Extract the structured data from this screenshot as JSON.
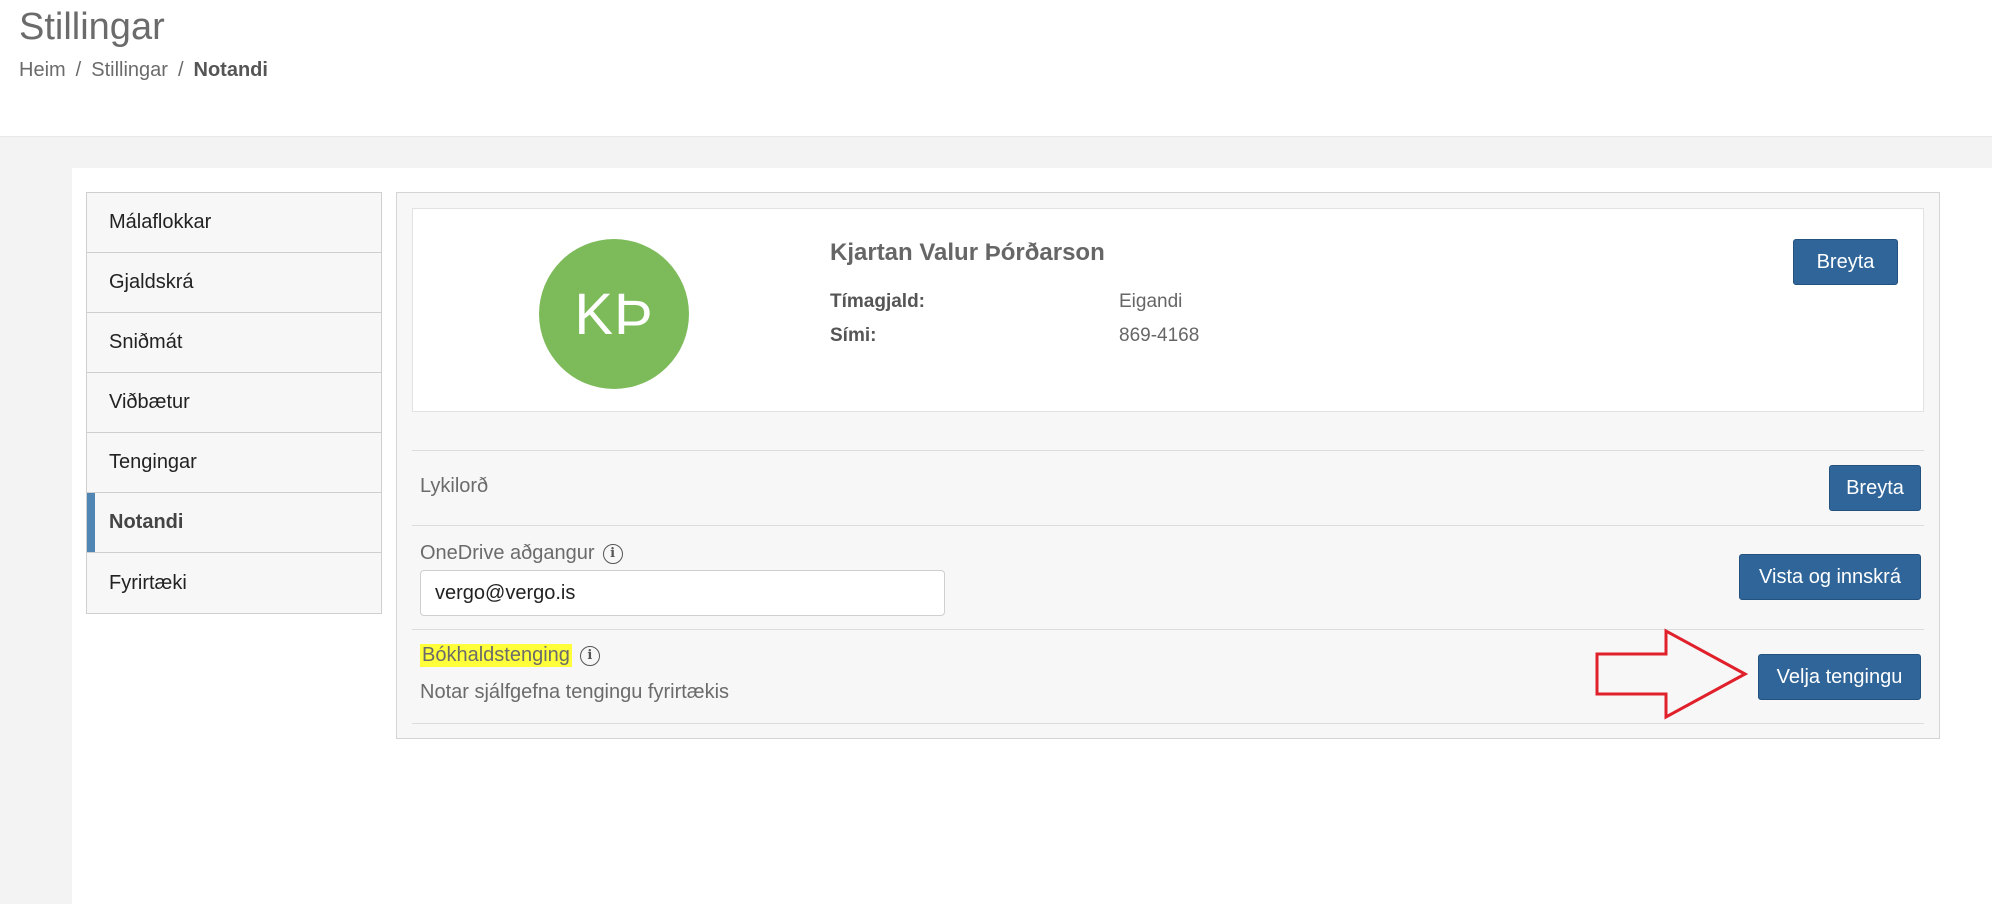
{
  "page": {
    "title": "Stillingar",
    "breadcrumb": [
      {
        "label": "Heim"
      },
      {
        "label": "Stillingar"
      },
      {
        "label": "Notandi"
      }
    ],
    "breadcrumb_separator": "/"
  },
  "sidebar": {
    "items": [
      {
        "label": "Málaflokkar",
        "active": false
      },
      {
        "label": "Gjaldskrá",
        "active": false
      },
      {
        "label": "Sniðmát",
        "active": false
      },
      {
        "label": "Viðbætur",
        "active": false
      },
      {
        "label": "Tengingar",
        "active": false
      },
      {
        "label": "Notandi",
        "active": true
      },
      {
        "label": "Fyrirtæki",
        "active": false
      }
    ]
  },
  "profile": {
    "initials": "KÞ",
    "name": "Kjartan Valur Þórðarson",
    "fields": [
      {
        "label": "Tímagjald:",
        "value": "Eigandi"
      },
      {
        "label": "Sími:",
        "value": "869-4168"
      }
    ],
    "edit_button": "Breyta",
    "avatar_color": "#7dbb5a"
  },
  "password_row": {
    "label": "Lykilorð",
    "button": "Breyta"
  },
  "onedrive_row": {
    "label": "OneDrive aðgangur",
    "email_value": "vergo@vergo.is",
    "button": "Vista og innskrá"
  },
  "accounting_row": {
    "label": "Bókhaldstenging",
    "description": "Notar sjálfgefna tengingu fyrirtækis",
    "button": "Velja tengingu"
  },
  "icons": {
    "info": "info-icon",
    "arrow": "right-arrow-annotation-icon"
  },
  "colors": {
    "primary_button": "#2f6599",
    "nav_active_accent": "#4f86b3",
    "highlight": "#ffff3a",
    "annotation_arrow": "#e0202a"
  }
}
